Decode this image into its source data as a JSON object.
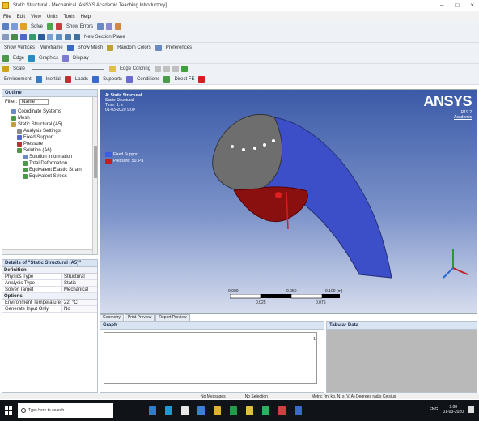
{
  "window": {
    "title": "Static Structural - Mechanical [ANSYS Academic Teaching Introductory]",
    "controls": [
      "–",
      "□",
      "×"
    ]
  },
  "menu": [
    "File",
    "Edit",
    "View",
    "Units",
    "Tools",
    "Help"
  ],
  "toolbars": {
    "row1": [
      "Solve",
      "Show Errors"
    ],
    "row2": [
      "New Section Plane"
    ],
    "row3": [
      "Show Vertices",
      "Wireframe",
      "Show Mesh",
      "Random Colors",
      "Preferences"
    ],
    "row4": [
      "Edge",
      "Graphics",
      "Display"
    ],
    "row5": [
      "Scale",
      "Edge Coloring"
    ],
    "row6": [
      "Environment",
      "Inertial",
      "Loads",
      "Supports",
      "Conditions",
      "Direct FE"
    ]
  },
  "outline": {
    "title": "Outline",
    "filter_label": "Filter:",
    "filter_value": "Name",
    "tree": [
      {
        "label": "Coordinate Systems",
        "indent": 1,
        "color": "#6a8ac6"
      },
      {
        "label": "Mesh",
        "indent": 1,
        "color": "#4a9a4a"
      },
      {
        "label": "Static Structural (A5)",
        "indent": 1,
        "color": "#c0a040"
      },
      {
        "label": "Analysis Settings",
        "indent": 2,
        "color": "#8a8a8a"
      },
      {
        "label": "Fixed Support",
        "indent": 2,
        "color": "#4a6ad6"
      },
      {
        "label": "Pressure",
        "indent": 2,
        "color": "#c03030"
      },
      {
        "label": "Solution (A6)",
        "indent": 2,
        "color": "#4a9a4a"
      },
      {
        "label": "Solution Information",
        "indent": 3,
        "color": "#6a8ac6"
      },
      {
        "label": "Total Deformation",
        "indent": 3,
        "color": "#4a9a4a"
      },
      {
        "label": "Equivalent Elastic Strain",
        "indent": 3,
        "color": "#4a9a4a"
      },
      {
        "label": "Equivalent Stress",
        "indent": 3,
        "color": "#4a9a4a"
      }
    ]
  },
  "details": {
    "title": "Details of \"Static Structural (A5)\"",
    "sections": [
      {
        "name": "Definition",
        "rows": [
          [
            "Physics Type",
            "Structural"
          ],
          [
            "Analysis Type",
            "Static Structural"
          ],
          [
            "Solver Target",
            "Mechanical APDL"
          ]
        ]
      },
      {
        "name": "Options",
        "rows": [
          [
            "Environment Temperature",
            "22. °C"
          ],
          [
            "Generate Input Only",
            "No"
          ]
        ]
      }
    ]
  },
  "viewport": {
    "info_title": "A: Static Structural",
    "info_lines": [
      "Static Structural",
      "Time: 1. s",
      "01-03-2020 9:00"
    ],
    "legend": [
      {
        "label": "Fixed Support",
        "color": "#3b5fe0"
      },
      {
        "label": "Pressure: 50. Pa",
        "color": "#c02020"
      }
    ],
    "brand": "ANSYS",
    "brand_version": "R19.2",
    "brand_edition": "Academic",
    "scale_top": [
      "0.000",
      "0.050",
      "0.100 (m)"
    ],
    "scale_bottom": [
      "0.025",
      "0.075"
    ]
  },
  "bottom_tabs": [
    "Geometry",
    "Print Preview",
    "Report Preview"
  ],
  "graph_title": "Graph",
  "graph_axis": "1",
  "tabular_title": "Tabular Data",
  "status": {
    "messages": "No Messages",
    "selection": "No Selection",
    "units": "Metric (m, kg, N, s, V, A)   Degrees   rad/s   Celsius"
  },
  "taskbar": {
    "search_placeholder": "Type here to search",
    "tasks": [
      "#2f7dd1",
      "#1a9ad6",
      "#e8e8e8",
      "#3d7fd8",
      "#e0b030",
      "#2a9a4a",
      "#e0c040",
      "#2fb060",
      "#d04040",
      "#3a6ad0"
    ],
    "clock_time": "9:00",
    "clock_date": "01-03-2020",
    "lang": "ENG"
  }
}
